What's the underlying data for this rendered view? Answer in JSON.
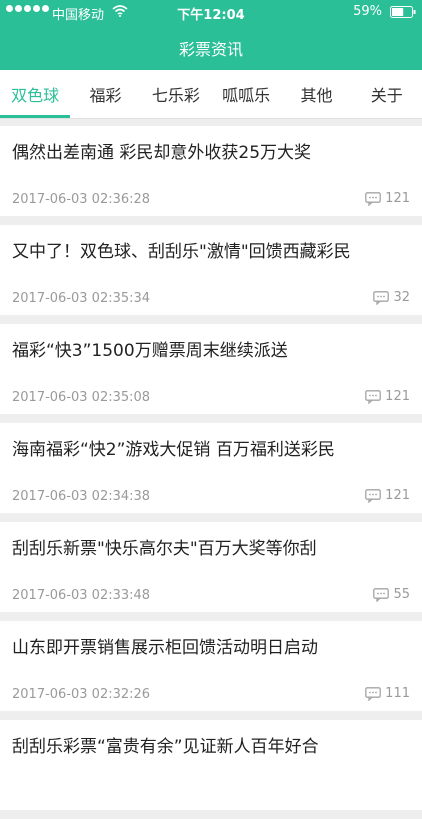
{
  "status_bar": {
    "carrier": "中国移动",
    "time": "下午12:04",
    "battery": "59%",
    "battery_level": 0.59
  },
  "nav": {
    "title": "彩票资讯"
  },
  "tabs": [
    {
      "label": "双色球",
      "active": true
    },
    {
      "label": "福彩",
      "active": false
    },
    {
      "label": "七乐彩",
      "active": false
    },
    {
      "label": "呱呱乐",
      "active": false
    },
    {
      "label": "其他",
      "active": false
    },
    {
      "label": "关于",
      "active": false
    }
  ],
  "articles": [
    {
      "title": "偶然出差南通 彩民却意外收获25万大奖",
      "date": "2017-06-03 02:36:28",
      "comments": "121"
    },
    {
      "title": "又中了！双色球、刮刮乐\"激情\"回馈西藏彩民",
      "date": "2017-06-03 02:35:34",
      "comments": "32"
    },
    {
      "title": "福彩“快3”1500万赠票周末继续派送",
      "date": "2017-06-03 02:35:08",
      "comments": "121"
    },
    {
      "title": "海南福彩“快2”游戏大促销 百万福利送彩民",
      "date": "2017-06-03 02:34:38",
      "comments": "121"
    },
    {
      "title": "刮刮乐新票\"快乐高尔夫\"百万大奖等你刮",
      "date": "2017-06-03 02:33:48",
      "comments": "55"
    },
    {
      "title": "山东即开票销售展示柜回馈活动明日启动",
      "date": "2017-06-03 02:32:26",
      "comments": "111"
    },
    {
      "title": "刮刮乐彩票“富贵有余”见证新人百年好合",
      "date": "",
      "comments": ""
    }
  ],
  "colors": {
    "accent": "#2bbf98",
    "background": "#eeeeee",
    "text": "#222222",
    "meta": "#9a9a9a"
  },
  "icons": {
    "comment": "comment-icon",
    "wifi": "wifi-icon",
    "battery": "battery-icon"
  }
}
